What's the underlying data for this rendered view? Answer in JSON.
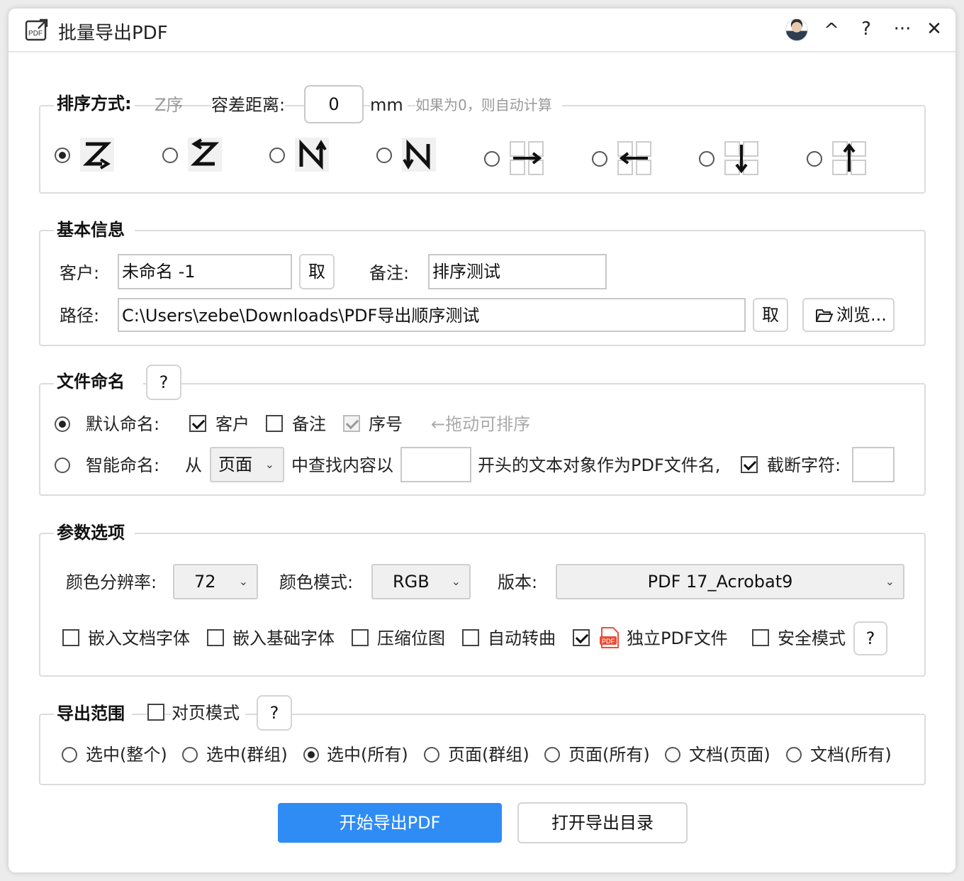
{
  "window": {
    "title": "批量导出PDF",
    "controls": {
      "collapse": "^",
      "help": "?",
      "more": "···",
      "close": "✕"
    }
  },
  "sorting": {
    "legend": "排序方式:",
    "current_label": "Z序",
    "tolerance_label": "容差距离:",
    "tolerance_value": "0",
    "unit": "mm",
    "hint": "如果为0，则自动计算",
    "options": [
      {
        "icon": "z-order-right-down-icon",
        "selected": true
      },
      {
        "icon": "z-order-left-down-icon",
        "selected": false
      },
      {
        "icon": "n-order-up-right-icon",
        "selected": false
      },
      {
        "icon": "n-order-down-left-icon",
        "selected": false
      },
      {
        "icon": "grid-arrow-right-icon",
        "selected": false
      },
      {
        "icon": "grid-arrow-left-icon",
        "selected": false
      },
      {
        "icon": "grid-arrow-down-icon",
        "selected": false
      },
      {
        "icon": "grid-arrow-up-icon",
        "selected": false
      }
    ]
  },
  "basic": {
    "legend": "基本信息",
    "client_label": "客户:",
    "client_value": "未命名 -1",
    "pick_label": "取",
    "note_label": "备注:",
    "note_value": "排序测试",
    "path_label": "路径:",
    "path_value": "C:\\Users\\zebe\\Downloads\\PDF导出顺序测试",
    "path_pick_label": "取",
    "browse_label": "浏览..."
  },
  "naming": {
    "legend": "文件命名",
    "help": "?",
    "default_label": "默认命名:",
    "client": "客户",
    "note": "备注",
    "seq": "序号",
    "drag_hint": "←拖动可排序",
    "smart_label": "智能命名:",
    "from": "从",
    "source_value": "页面",
    "find_label": "中查找内容以",
    "find_value": "",
    "tail_label": "开头的文本对象作为PDF文件名,",
    "truncate_label": "截断字符:",
    "truncate_value": ""
  },
  "params": {
    "legend": "参数选项",
    "res_label": "颜色分辨率:",
    "res_value": "72",
    "mode_label": "颜色模式:",
    "mode_value": "RGB",
    "ver_label": "版本:",
    "ver_value": "PDF 17_Acrobat9",
    "opts": {
      "embed_doc_fonts": "嵌入文档字体",
      "embed_base_fonts": "嵌入基础字体",
      "compress_bitmap": "压缩位图",
      "auto_convert": "自动转曲",
      "separate_pdf": "独立PDF文件",
      "safe_mode": "安全模式"
    },
    "help": "?"
  },
  "range": {
    "legend": "导出范围",
    "facing_label": "对页模式",
    "help": "?",
    "options": [
      "选中(整个)",
      "选中(群组)",
      "选中(所有)",
      "页面(群组)",
      "页面(所有)",
      "文档(页面)",
      "文档(所有)"
    ],
    "selected_index": 2
  },
  "footer": {
    "start": "开始导出PDF",
    "open_dir": "打开导出目录"
  },
  "colors": {
    "primary": "#2f8cf4",
    "pdf_icon": "#e8503a"
  }
}
